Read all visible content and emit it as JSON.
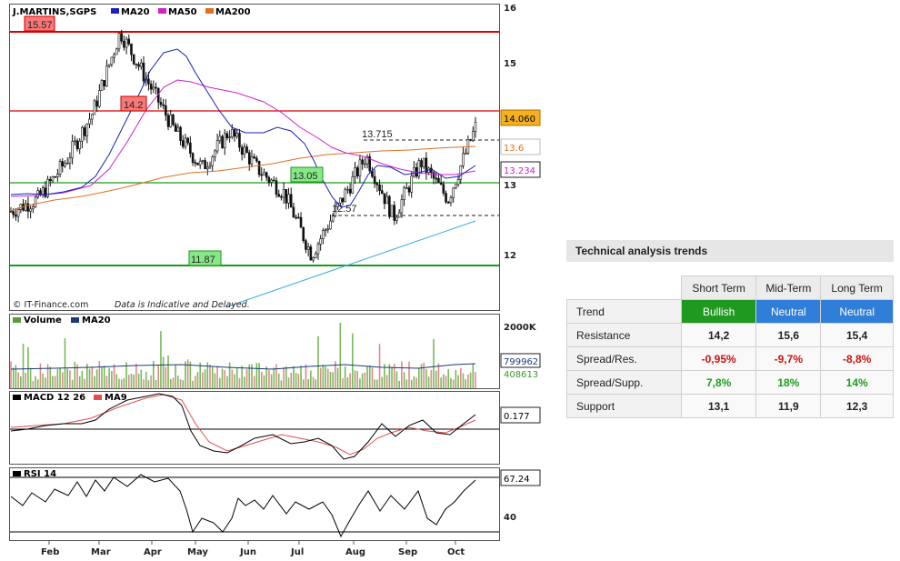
{
  "chart_data": [
    {
      "type": "candlestick",
      "title": "J.MARTINS,SGPS",
      "legend": [
        "MA20",
        "MA50",
        "MA200"
      ],
      "legend_colors": {
        "MA20": "#1a22bb",
        "MA50": "#cc22cc",
        "MA200": "#e07020"
      },
      "credit": "© IT-Finance.com",
      "disclaimer": "Data is Indicative and Delayed.",
      "ylim": [
        11.5,
        16.05
      ],
      "y_ticks": [
        "16",
        "15",
        "13",
        "12"
      ],
      "x_ticks": [
        "Feb",
        "Mar",
        "Apr",
        "May",
        "Jun",
        "Jul",
        "Aug",
        "Sep",
        "Oct"
      ],
      "last_price": "14.060",
      "ma50_value": "13.234",
      "ma200_value": "13.6",
      "levels": [
        {
          "label": "15.57",
          "value": 15.57,
          "color": "#dd0000"
        },
        {
          "label": "14.2",
          "value": 14.2,
          "color": "#dd0000"
        },
        {
          "label": "13.05",
          "value": 13.05,
          "color": "#1a9a1a"
        },
        {
          "label": "11.87",
          "value": 11.87,
          "color": "#1a9a1a"
        }
      ],
      "annotations": [
        "13.715",
        "12.57"
      ],
      "close_points": [
        [
          "Jan",
          12.7
        ],
        [
          "Feb",
          12.9
        ],
        [
          "Feb",
          13.5
        ],
        [
          "Mar",
          14.3
        ],
        [
          "Apr",
          15.6
        ],
        [
          "May",
          14.8
        ],
        [
          "May",
          14.0
        ],
        [
          "Jun",
          13.4
        ],
        [
          "Jun",
          14.0
        ],
        [
          "Jul",
          13.4
        ],
        [
          "Jul",
          13.0
        ],
        [
          "Jul",
          12.0
        ],
        [
          "Aug",
          12.8
        ],
        [
          "Aug",
          13.6
        ],
        [
          "Sep",
          12.6
        ],
        [
          "Sep",
          13.5
        ],
        [
          "Oct",
          12.9
        ],
        [
          "Oct",
          14.06
        ]
      ]
    },
    {
      "type": "bar",
      "title": "Volume",
      "legend": [
        "Volume",
        "MA20"
      ],
      "y_tick": "2000K",
      "ma20_value": "799962",
      "last_volume": "408613"
    },
    {
      "type": "line",
      "title": "MACD 12 26",
      "legend": [
        "MACD 12 26",
        "MA9"
      ],
      "last_value": "0.177"
    },
    {
      "type": "line",
      "title": "RSI 14",
      "last_value": "67.24",
      "y_tick": "40"
    }
  ],
  "trends": {
    "title": "Technical analysis trends",
    "columns": [
      "Short Term",
      "Mid-Term",
      "Long Term"
    ],
    "rows": [
      {
        "label": "Trend",
        "values": [
          "Bullish",
          "Neutral",
          "Neutral"
        ]
      },
      {
        "label": "Resistance",
        "values": [
          "14,2",
          "15,6",
          "15,4"
        ]
      },
      {
        "label": "Spread/Res.",
        "values": [
          "-0,95%",
          "-9,7%",
          "-8,8%"
        ]
      },
      {
        "label": "Spread/Supp.",
        "values": [
          "7,8%",
          "18%",
          "14%"
        ]
      },
      {
        "label": "Support",
        "values": [
          "13,1",
          "11,9",
          "12,3"
        ]
      }
    ]
  }
}
